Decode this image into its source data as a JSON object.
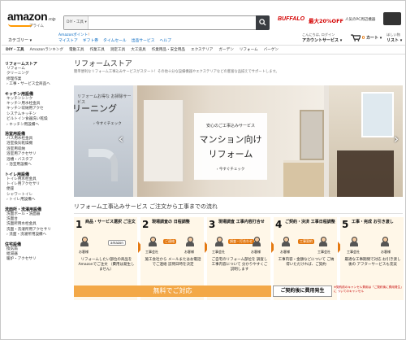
{
  "header": {
    "logo": "amazon",
    "logo_suffix": ".co.jp",
    "logo_sub": "プライム",
    "search_category": "DIY・工具",
    "search_placeholder": "",
    "promo_brand": "BUFFALO",
    "promo_text": "最大20%OFF",
    "promo_sub": "人気のPC周辺機器",
    "points_link": "Amazonポイント",
    "points_suffix": "!",
    "nav_links": [
      "マイストア",
      "ギフト券",
      "タイムセール",
      "出品サービス",
      "ヘルプ"
    ],
    "category_button": "カテゴリー ▾",
    "greeting": "こんにちは, ログイン",
    "account_label": "アカウントサービス ▾",
    "cart_label": "カート ▾",
    "cart_count": "0",
    "list_top": "ほしい物",
    "list_label": "リスト ▾"
  },
  "subnav": [
    "DIY・工具",
    "Amazonランキング",
    "電動工具",
    "作業工具",
    "測定工具",
    "大工道具",
    "作業用品・安全用品",
    "エクステリア",
    "ガーデン",
    "リフォーム",
    "バーゲン"
  ],
  "sidebar": {
    "sections": [
      {
        "heading": "リフォームストア",
        "items": [
          "リフォーム",
          "クリーニング",
          "修理作業"
        ],
        "more": "› 工事・サービス全商品へ"
      },
      {
        "heading": "キッチン用設備",
        "items": [
          "キッチンシンク",
          "キッチン用水栓金具",
          "キッチン収納用アクセ",
          "システムキッチン",
          "ビルトイン食器洗い乾燥"
        ],
        "more": "› キッチン用設備へ"
      },
      {
        "heading": "浴室用設備",
        "items": [
          "バス用水栓金具",
          "浴室換気乾燥機",
          "浴室用収納",
          "浴室用アクセサリ",
          "浴槽・バスタブ"
        ],
        "more": "› 浴室用設備へ"
      },
      {
        "heading": "トイレ用設備",
        "items": [
          "トイレ用水栓金具",
          "トイレ用アクセサリ",
          "便座",
          "シャワートイレ"
        ],
        "more": "› トイレ用設備へ"
      },
      {
        "heading": "洗面所・洗濯用設備",
        "items": [
          "洗面ボール・洗面器",
          "洗面台",
          "洗面所用水栓金具",
          "洗面・洗濯所用アクセサリ"
        ],
        "more": "› 洗面・洗濯所用設備へ"
      },
      {
        "heading": "住宅設備",
        "items": [
          "換気扇",
          "給湯器",
          "暖炉・アクセサリ"
        ],
        "more": ""
      }
    ]
  },
  "main": {
    "title": "リフォームストア",
    "description": "簡単便利なリフォーム工事込みサービスがスタート！その他十分な設備機器やエクステリアなどの豊富な品揃えでサポートします。",
    "hero": {
      "left_small": "リフォームお得な お掃除サービス",
      "left_big": "リーニング",
      "left_check": "› 今すぐチェック",
      "center_small": "安心のご工事込みサービス",
      "center_big1": "マンション向け",
      "center_big2": "リフォーム",
      "center_check": "› 今すぐチェック",
      "arrow_left": "‹",
      "arrow_right": "›"
    },
    "flow_title": "リフォーム工事込みサービス ご注文から工事までの流れ",
    "steps": [
      {
        "num": "1",
        "title": "商品・サービス選択 ご注文",
        "label_a": "お客様",
        "tag": "amazon",
        "body": "リフォームしたい部位の商品をAmazonでご注文 （費用は発生しません）"
      },
      {
        "num": "2",
        "title": "現場調査の 日程調整",
        "label_a": "工事会社",
        "label_b": "お客様",
        "tag": "ご連絡",
        "body": "施工会社から メールまたはお電話でご連絡 訪問日時を決定"
      },
      {
        "num": "3",
        "title": "現場調査 工事内容打合せ",
        "label_a": "工事会社",
        "label_b": "お客様",
        "tag": "調査・打合わせ",
        "body": "ご自宅のリフォーム部位を 調査し工事内容について 分かりやすくご説明します"
      },
      {
        "num": "4",
        "title": "ご契約・決済 工事日程調整",
        "label_a": "お客様",
        "label_b": "工事会社",
        "tag": "工事契約",
        "body": "工事内容・金額などについて ご納得いただければ、ご契約"
      },
      {
        "num": "5",
        "title": "工事・完成 お引き渡し",
        "label_a": "工事会社",
        "label_b": "お客様",
        "tag": "",
        "body": "最適な工事期間で対応 お引き渡し後の アフターサービスも充実"
      }
    ],
    "bar_free": "無料でご対応",
    "bar_paid": "ご契約後に費用発生",
    "bar_note": "※契約前のキャンセル費用は「ご契約後に費用発生」に ついてのキャンセル"
  }
}
